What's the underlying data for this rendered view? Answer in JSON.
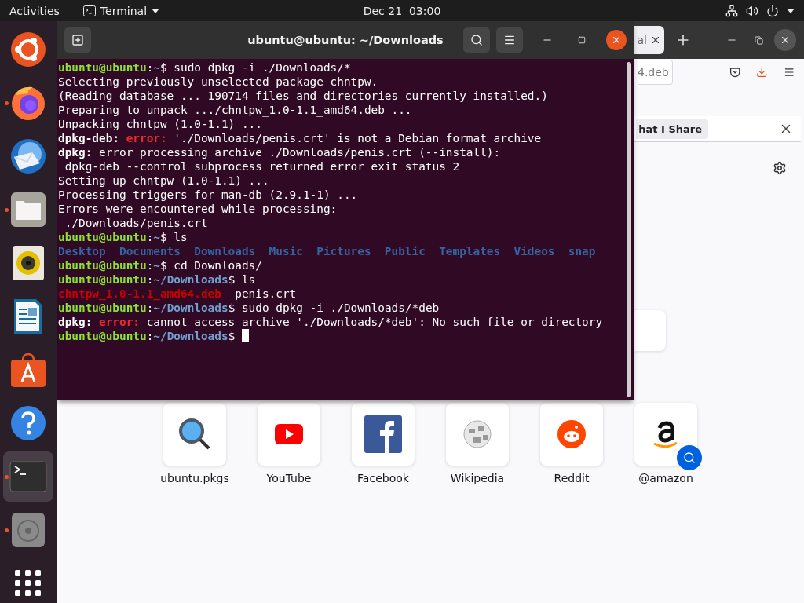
{
  "top_bar": {
    "activities": "Activities",
    "app_menu": "Terminal",
    "clock": "Dec 21  03:00"
  },
  "dock": {
    "items": [
      {
        "kind": "ubuntu",
        "running": false,
        "selected": false
      },
      {
        "kind": "firefox",
        "running": true,
        "selected": false
      },
      {
        "kind": "mail",
        "running": false,
        "selected": false
      },
      {
        "kind": "files",
        "running": true,
        "selected": false
      },
      {
        "kind": "music",
        "running": false,
        "selected": false
      },
      {
        "kind": "writer",
        "running": false,
        "selected": false
      },
      {
        "kind": "software",
        "running": false,
        "selected": false
      },
      {
        "kind": "help",
        "running": false,
        "selected": false
      },
      {
        "kind": "terminal",
        "running": true,
        "selected": true
      },
      {
        "kind": "disc",
        "running": true,
        "selected": false
      },
      {
        "kind": "apps",
        "running": false,
        "selected": false
      }
    ]
  },
  "browser": {
    "tab": {
      "title": "al"
    },
    "address": "4.deb",
    "notice": "hat I Share",
    "top_sites": [
      {
        "kind": "search",
        "label": "ubuntu.pkgs"
      },
      {
        "kind": "youtube",
        "label": "YouTube"
      },
      {
        "kind": "facebook",
        "label": "Facebook"
      },
      {
        "kind": "wikipedia",
        "label": "Wikipedia"
      },
      {
        "kind": "reddit",
        "label": "Reddit"
      },
      {
        "kind": "amazon",
        "label": "@amazon"
      }
    ]
  },
  "terminal": {
    "title": "ubuntu@ubuntu: ~/Downloads",
    "lines": [
      {
        "segments": [
          {
            "kind": "user",
            "text": "ubuntu@ubuntu"
          },
          {
            "kind": "plain",
            "text": ":"
          },
          {
            "kind": "path",
            "text": "~"
          },
          {
            "kind": "plain",
            "text": "$ sudo dpkg -i ./Downloads/*"
          }
        ]
      },
      {
        "segments": [
          {
            "kind": "plain",
            "text": "Selecting previously unselected package chntpw."
          }
        ]
      },
      {
        "segments": [
          {
            "kind": "plain",
            "text": "(Reading database ... 190714 files and directories currently installed.)"
          }
        ]
      },
      {
        "segments": [
          {
            "kind": "plain",
            "text": "Preparing to unpack .../chntpw_1.0-1.1_amd64.deb ..."
          }
        ]
      },
      {
        "segments": [
          {
            "kind": "plain",
            "text": "Unpacking chntpw (1.0-1.1) ..."
          }
        ]
      },
      {
        "segments": [
          {
            "kind": "bold",
            "text": "dpkg-deb: "
          },
          {
            "kind": "error",
            "text": "error:"
          },
          {
            "kind": "plain",
            "text": " './Downloads/penis.crt' is not a Debian format archive"
          }
        ]
      },
      {
        "segments": [
          {
            "kind": "bold",
            "text": "dpkg:"
          },
          {
            "kind": "plain",
            "text": " error processing archive ./Downloads/penis.crt (--install):"
          }
        ]
      },
      {
        "segments": [
          {
            "kind": "plain",
            "text": " dpkg-deb --control subprocess returned error exit status 2"
          }
        ]
      },
      {
        "segments": [
          {
            "kind": "plain",
            "text": "Setting up chntpw (1.0-1.1) ..."
          }
        ]
      },
      {
        "segments": [
          {
            "kind": "plain",
            "text": "Processing triggers for man-db (2.9.1-1) ..."
          }
        ]
      },
      {
        "segments": [
          {
            "kind": "plain",
            "text": "Errors were encountered while processing:"
          }
        ]
      },
      {
        "segments": [
          {
            "kind": "plain",
            "text": " ./Downloads/penis.crt"
          }
        ]
      },
      {
        "segments": [
          {
            "kind": "user",
            "text": "ubuntu@ubuntu"
          },
          {
            "kind": "plain",
            "text": ":"
          },
          {
            "kind": "path",
            "text": "~"
          },
          {
            "kind": "plain",
            "text": "$ ls"
          }
        ]
      },
      {
        "segments": [
          {
            "kind": "dir",
            "text": "Desktop  Documents  Downloads  Music  Pictures  Public  Templates  Videos  snap"
          }
        ]
      },
      {
        "segments": [
          {
            "kind": "user",
            "text": "ubuntu@ubuntu"
          },
          {
            "kind": "plain",
            "text": ":"
          },
          {
            "kind": "path",
            "text": "~"
          },
          {
            "kind": "plain",
            "text": "$ cd Downloads/"
          }
        ]
      },
      {
        "segments": [
          {
            "kind": "user",
            "text": "ubuntu@ubuntu"
          },
          {
            "kind": "plain",
            "text": ":"
          },
          {
            "kind": "path",
            "text": "~/Downloads"
          },
          {
            "kind": "plain",
            "text": "$ ls"
          }
        ]
      },
      {
        "segments": [
          {
            "kind": "deb",
            "text": "chntpw_1.0-1.1_amd64.deb"
          },
          {
            "kind": "plain",
            "text": "  penis.crt"
          }
        ]
      },
      {
        "segments": [
          {
            "kind": "user",
            "text": "ubuntu@ubuntu"
          },
          {
            "kind": "plain",
            "text": ":"
          },
          {
            "kind": "path",
            "text": "~/Downloads"
          },
          {
            "kind": "plain",
            "text": "$ sudo dpkg -i ./Downloads/*deb"
          }
        ]
      },
      {
        "segments": [
          {
            "kind": "bold",
            "text": "dpkg: "
          },
          {
            "kind": "error",
            "text": "error:"
          },
          {
            "kind": "plain",
            "text": " cannot access archive './Downloads/*deb': No such file or directory"
          }
        ]
      },
      {
        "segments": [
          {
            "kind": "user",
            "text": "ubuntu@ubuntu"
          },
          {
            "kind": "plain",
            "text": ":"
          },
          {
            "kind": "path",
            "text": "~/Downloads"
          },
          {
            "kind": "plain",
            "text": "$"
          }
        ],
        "cursor": true
      }
    ]
  }
}
